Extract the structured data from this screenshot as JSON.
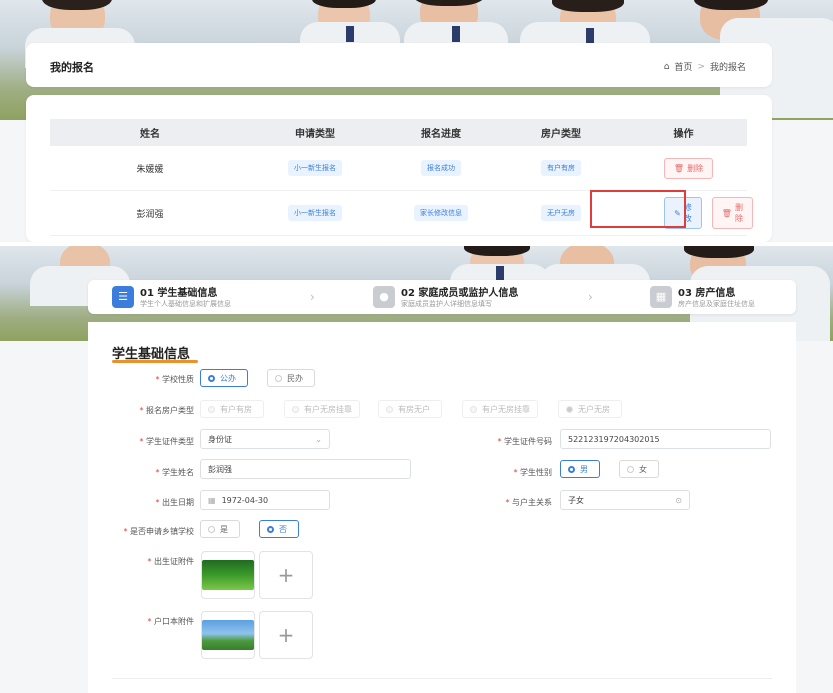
{
  "page": {
    "title": "我的报名"
  },
  "breadcrumb": {
    "home": "首页",
    "sep": ">",
    "current": "我的报名"
  },
  "table": {
    "headers": [
      "姓名",
      "申请类型",
      "报名进度",
      "房户类型",
      "操作"
    ],
    "rows": [
      {
        "name": "朱媛媛",
        "apply_type": "小一新生报名",
        "progress": "报名成功",
        "house_type": "有户有房",
        "actions": [
          "删除"
        ]
      },
      {
        "name": "彭润强",
        "apply_type": "小一新生报名",
        "progress": "家长修改信息",
        "house_type": "无户无房",
        "actions": [
          "修改",
          "删除"
        ]
      }
    ]
  },
  "steps": [
    {
      "title": "01 学生基础信息",
      "subtitle": "学生个人基础信息和扩展信息"
    },
    {
      "title": "02 家庭成员或监护人信息",
      "subtitle": "家庭成员监护人详细信息填写"
    },
    {
      "title": "03 房产信息",
      "subtitle": "房产信息及家庭住址信息"
    }
  ],
  "form": {
    "section_title": "学生基础信息",
    "school_type": {
      "label": "学校性质",
      "options": [
        "公办",
        "民办"
      ],
      "selected": "公办"
    },
    "house_type": {
      "label": "报名房户类型",
      "options": [
        "有户有房",
        "有户无房挂靠",
        "有房无户",
        "有户无房挂靠",
        "无户无房"
      ],
      "selected": "无户无房"
    },
    "id_type": {
      "label": "学生证件类型",
      "value": "身份证"
    },
    "id_number": {
      "label": "学生证件号码",
      "value": "522123197204302015"
    },
    "student_name": {
      "label": "学生姓名",
      "value": "彭润强"
    },
    "gender": {
      "label": "学生性别",
      "options": [
        "男",
        "女"
      ],
      "selected": "男"
    },
    "birth_date": {
      "label": "出生日期",
      "value": "1972-04-30"
    },
    "relation": {
      "label": "与户主关系",
      "value": "子女"
    },
    "rural_school": {
      "label": "是否申请乡镇学校",
      "options": [
        "是",
        "否"
      ],
      "selected": "否"
    },
    "birth_cert": {
      "label": "出生证附件"
    },
    "hukou": {
      "label": "户口本附件"
    }
  },
  "colors": {
    "accent": "#3b7ddd",
    "danger": "#e86a6a",
    "section_underline": "#e8922e",
    "highlight": "#e23b3b"
  }
}
